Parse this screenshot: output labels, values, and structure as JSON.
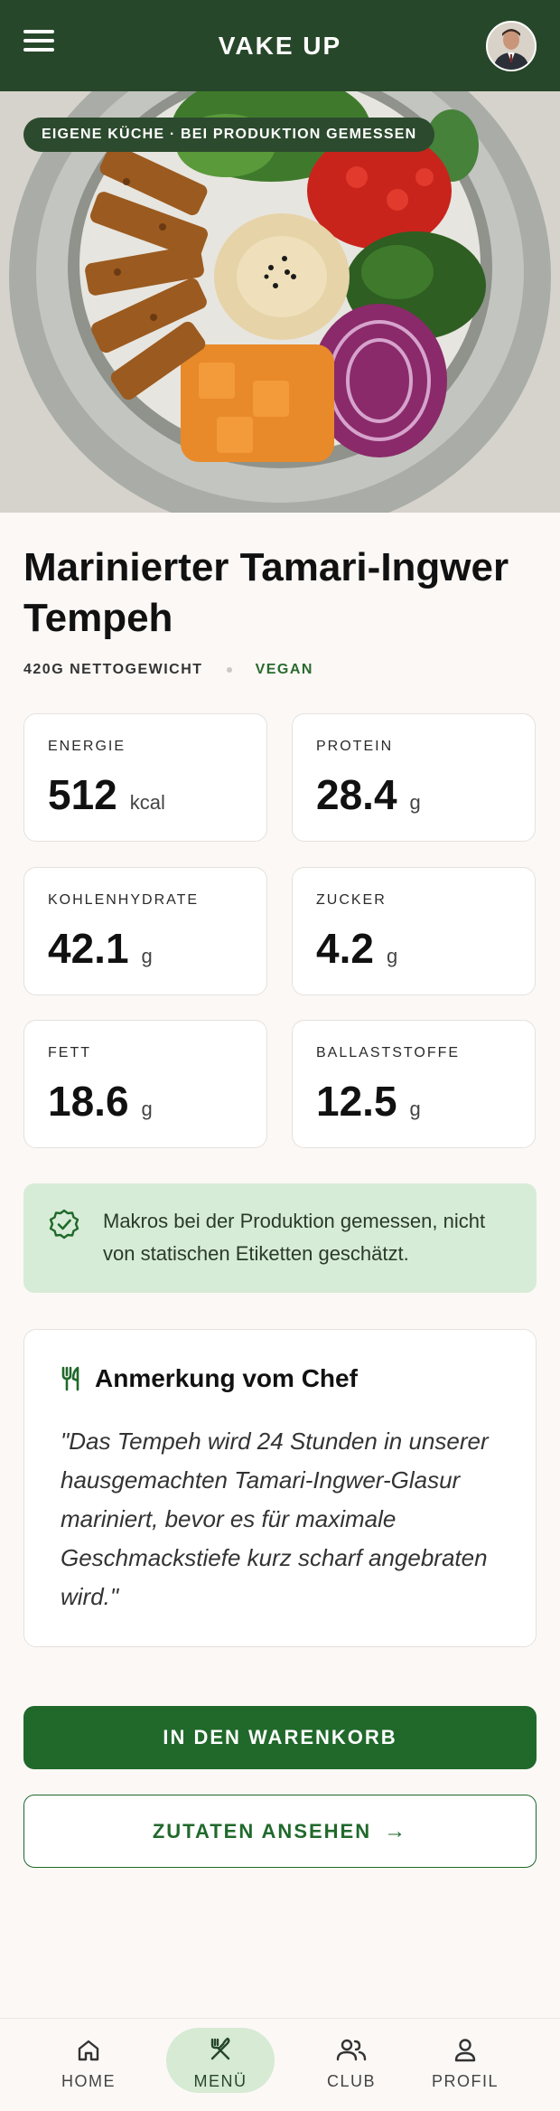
{
  "header": {
    "brand": "VAKE UP",
    "menu_icon": "hamburger-menu-icon",
    "avatar_icon": "user-avatar"
  },
  "hero": {
    "badge": "EIGENE KÜCHE · BEI PRODUKTION GEMESSEN"
  },
  "product": {
    "title": "Marinierter Tamari-Ingwer Tempeh",
    "weight": "420G NETTOGEWICHT",
    "tag": "VEGAN"
  },
  "nutrition": [
    {
      "label": "ENERGIE",
      "value": "512",
      "unit": "kcal"
    },
    {
      "label": "PROTEIN",
      "value": "28.4",
      "unit": "g"
    },
    {
      "label": "KOHLENHYDRATE",
      "value": "42.1",
      "unit": "g"
    },
    {
      "label": "ZUCKER",
      "value": "4.2",
      "unit": "g"
    },
    {
      "label": "FETT",
      "value": "18.6",
      "unit": "g"
    },
    {
      "label": "BALLASTSTOFFE",
      "value": "12.5",
      "unit": "g"
    }
  ],
  "info": {
    "text": "Makros bei der Produktion gemessen, nicht von statischen Etiketten geschätzt.",
    "icon": "verified-check-icon"
  },
  "chef_note": {
    "title": "Anmerkung vom Chef",
    "icon": "utensils-icon",
    "quote": "\"Das Tempeh wird 24 Stunden in unserer hausgemachten Tamari-Ingwer-Glasur mariniert, bevor es für maximale Geschmackstiefe kurz scharf angebraten wird.\""
  },
  "actions": {
    "add_to_cart": "IN DEN WARENKORB",
    "view_ingredients": "ZUTATEN ANSEHEN",
    "arrow": "→"
  },
  "bottom_nav": [
    {
      "label": "HOME",
      "icon": "home-icon",
      "active": false
    },
    {
      "label": "MENÜ",
      "icon": "utensils-cross-icon",
      "active": true
    },
    {
      "label": "CLUB",
      "icon": "users-icon",
      "active": false
    },
    {
      "label": "PROFIL",
      "icon": "user-icon",
      "active": false
    }
  ],
  "colors": {
    "header_bg": "#27472a",
    "accent_green": "#20692b",
    "info_bg": "#d7ecd6",
    "page_bg": "#fbf8f6"
  }
}
